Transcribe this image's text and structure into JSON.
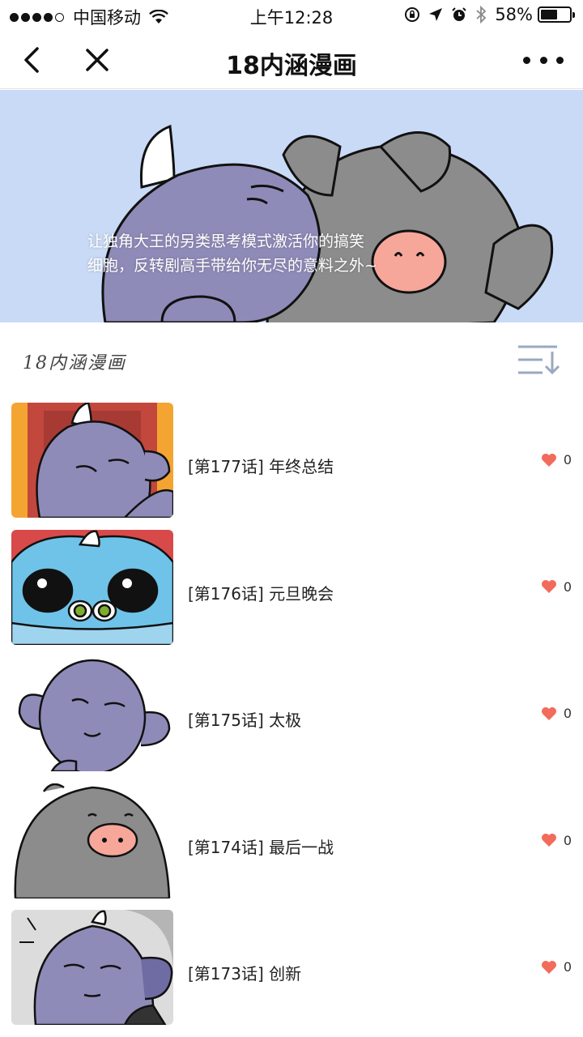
{
  "status_bar": {
    "carrier": "中国移动",
    "time": "上午12:28",
    "battery": "58%",
    "battery_level": 0.58
  },
  "nav": {
    "title": "18内涵漫画",
    "back_icon": "chevron-left-icon",
    "close_icon": "close-icon",
    "more_icon": "more-dots-icon"
  },
  "banner": {
    "description": "让独角大王的另类思考模式激活你的搞笑细胞，反转剧高手带给你无尽的意料之外~",
    "background": "#c9daf6"
  },
  "section": {
    "logo_text": "18内涵漫画",
    "sort_icon": "sort-icon"
  },
  "episodes": [
    {
      "title": "[第177话] 年终总结",
      "likes": "0"
    },
    {
      "title": "[第176话] 元旦晚会",
      "likes": "0"
    },
    {
      "title": "[第175话] 太极",
      "likes": "0"
    },
    {
      "title": "[第174话] 最后一战",
      "likes": "0"
    },
    {
      "title": "[第173话] 创新",
      "likes": "0"
    }
  ],
  "colors": {
    "heart": "#f26b5b",
    "character_purple": "#8f8bb8",
    "character_gray": "#8c8c8c",
    "snout_pink": "#f6a79a"
  }
}
